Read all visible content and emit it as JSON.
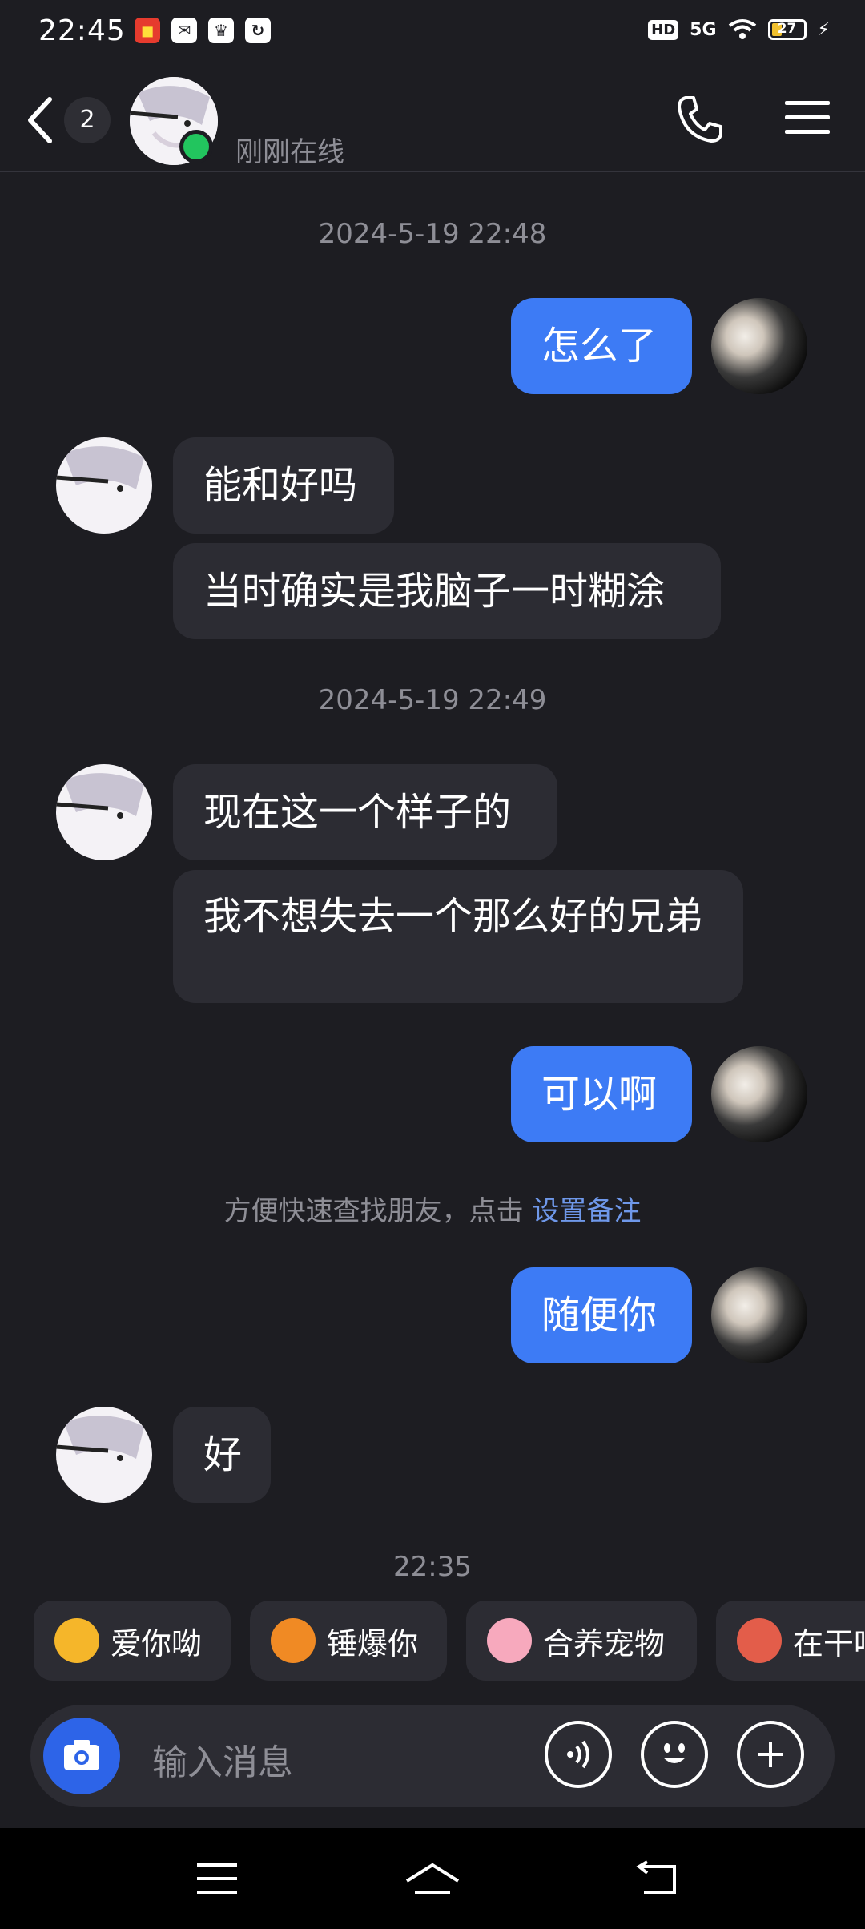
{
  "status_bar": {
    "time": "22:45",
    "network_label": "HD",
    "signal_label": "5G",
    "battery_level": "27"
  },
  "header": {
    "back_icon": "chevron-left-icon",
    "unread_count": "2",
    "presence": "刚刚在线",
    "call_icon": "phone-icon",
    "menu_icon": "hamburger-menu-icon"
  },
  "chat": {
    "timestamps": [
      "2024-5-19 22:48",
      "2024-5-19 22:49",
      "22:35"
    ],
    "messages": [
      {
        "side": "right",
        "text": "怎么了"
      },
      {
        "side": "left",
        "text": "能和好吗"
      },
      {
        "side": "left",
        "text": "当时确实是我脑子一时糊涂"
      },
      {
        "side": "left",
        "text": "现在这一个样子的"
      },
      {
        "side": "left",
        "text": "我不想失去一个那么好的兄弟"
      },
      {
        "side": "right",
        "text": "可以啊"
      },
      {
        "side": "right",
        "text": "随便你"
      },
      {
        "side": "left",
        "text": "好"
      }
    ],
    "system_note": {
      "text": "方便快速查找朋友，点击 ",
      "link": "设置备注"
    }
  },
  "quick_replies": [
    {
      "label": "爱你呦",
      "icon": "heart-eyes-emoji-icon"
    },
    {
      "label": "锤爆你",
      "icon": "hammer-emoji-icon"
    },
    {
      "label": "合养宠物",
      "icon": "pet-emoji-icon"
    },
    {
      "label": "在干吗",
      "icon": "thinking-emoji-icon"
    }
  ],
  "input": {
    "placeholder": "输入消息",
    "camera_icon": "camera-icon",
    "voice_icon": "voice-icon",
    "emoji_icon": "smiley-icon",
    "plus_icon": "plus-icon"
  },
  "colors": {
    "background": "#1d1d22",
    "bubble_left": "#2c2c33",
    "bubble_right": "#3d7bf5",
    "online": "#22c55e",
    "link": "#6f98ea"
  }
}
